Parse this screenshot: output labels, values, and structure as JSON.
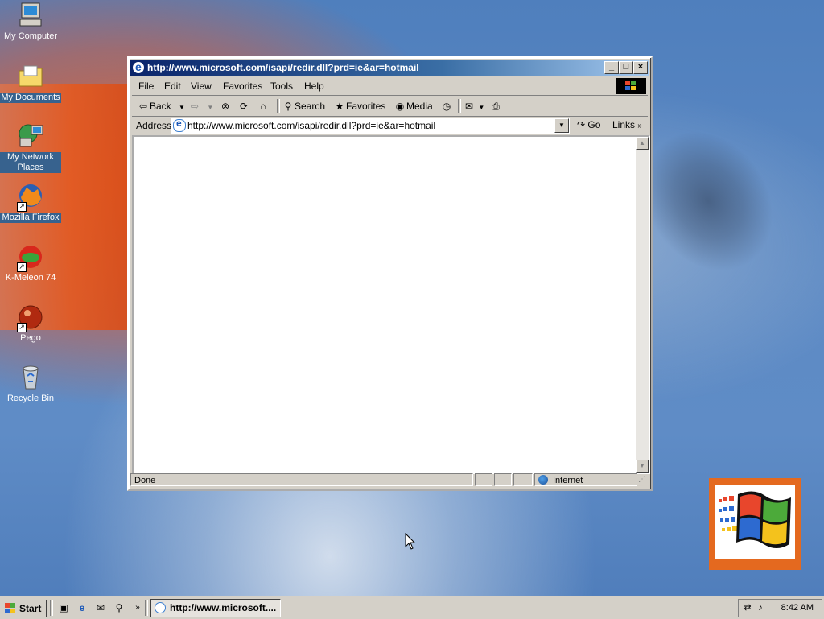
{
  "desktop": {
    "icons": [
      {
        "label": "My Computer"
      },
      {
        "label": "My Documents"
      },
      {
        "label": "My Network Places"
      },
      {
        "label": "Mozilla Firefox"
      },
      {
        "label": "K-Meleon 74"
      },
      {
        "label": "Pego"
      },
      {
        "label": "Recycle Bin"
      }
    ]
  },
  "window": {
    "title": "http://www.microsoft.com/isapi/redir.dll?prd=ie&ar=hotmail",
    "menu": [
      "File",
      "Edit",
      "View",
      "Favorites",
      "Tools",
      "Help"
    ],
    "toolbar": {
      "back": "Back",
      "search": "Search",
      "favorites": "Favorites",
      "media": "Media"
    },
    "address": {
      "label": "Address",
      "value": "http://www.microsoft.com/isapi/redir.dll?prd=ie&ar=hotmail",
      "go": "Go",
      "links": "Links"
    },
    "status": {
      "text": "Done",
      "zone": "Internet"
    }
  },
  "taskbar": {
    "start": "Start",
    "task_title": "http://www.microsoft....",
    "clock": "8:42 AM"
  },
  "colors": {
    "titlebar_start": "#0a246a",
    "titlebar_end": "#a6caf0",
    "face": "#d4d0c8",
    "logo_frame": "#e4691f"
  }
}
